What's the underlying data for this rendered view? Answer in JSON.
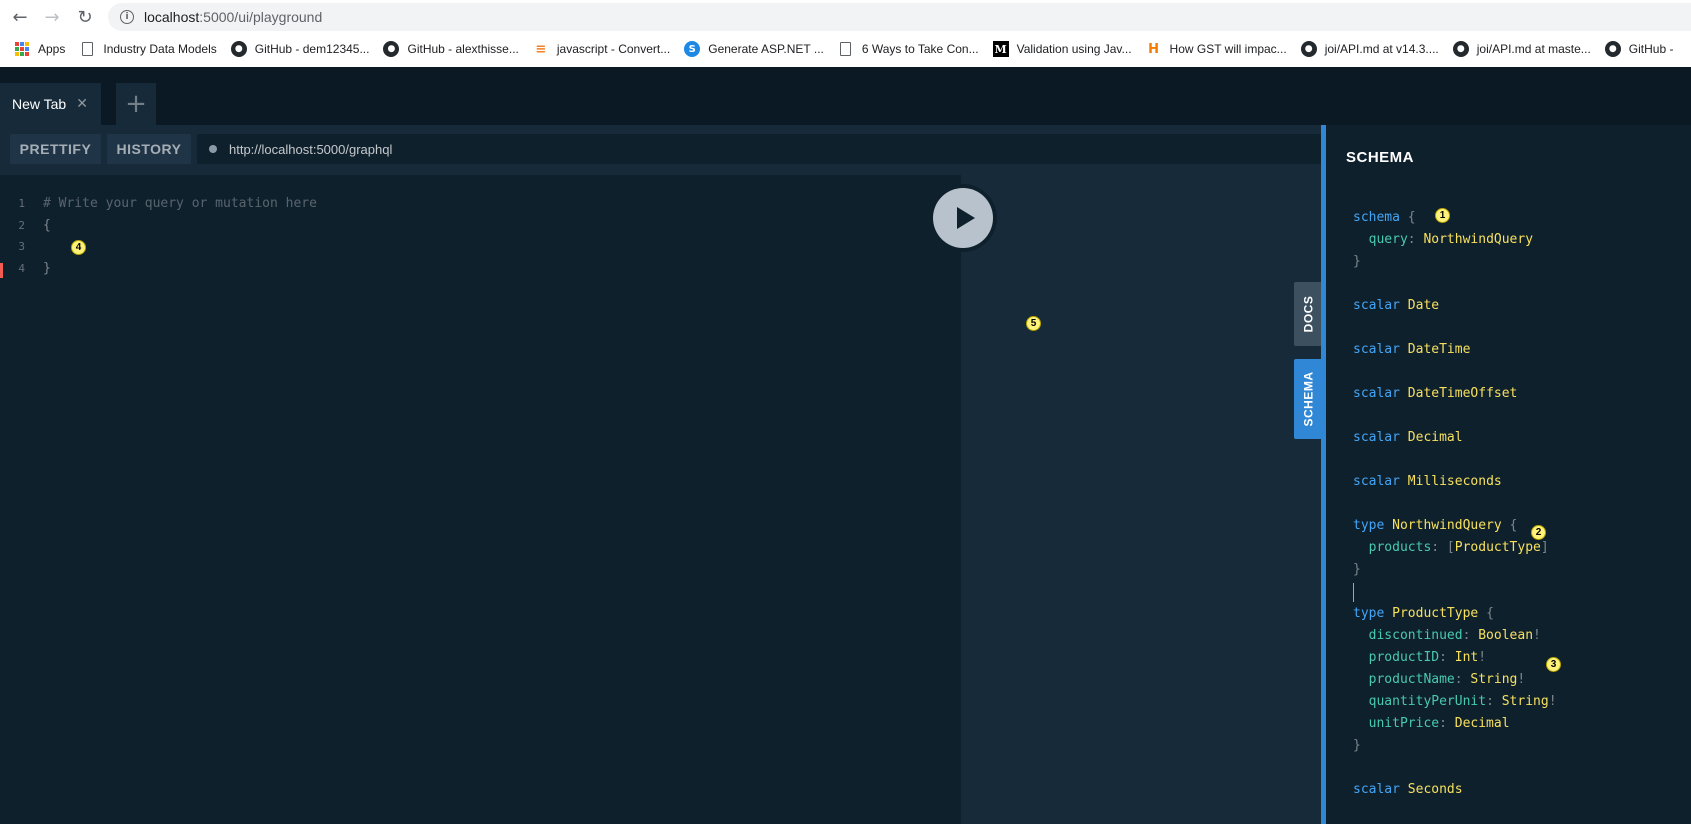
{
  "browser": {
    "url_host": "localhost",
    "url_rest": ":5000/ui/playground",
    "bookmarks": [
      {
        "label": "Apps",
        "icon": "apps-grid-icon"
      },
      {
        "label": "Industry Data Models",
        "icon": "page-icon"
      },
      {
        "label": "GitHub - dem12345...",
        "icon": "github-icon"
      },
      {
        "label": "GitHub - alexthisse...",
        "icon": "github-icon"
      },
      {
        "label": "javascript - Convert...",
        "icon": "stackoverflow-icon"
      },
      {
        "label": "Generate ASP.NET ...",
        "icon": "generic-site-icon"
      },
      {
        "label": "6 Ways to Take Con...",
        "icon": "page-icon"
      },
      {
        "label": "Validation using Jav...",
        "icon": "medium-icon"
      },
      {
        "label": "How GST will impac...",
        "icon": "h-site-icon"
      },
      {
        "label": "joi/API.md at v14.3....",
        "icon": "github-icon"
      },
      {
        "label": "joi/API.md at maste...",
        "icon": "github-icon"
      },
      {
        "label": "GitHub -",
        "icon": "github-icon"
      }
    ]
  },
  "tabs": {
    "active_title": "New Tab",
    "close_glyph": "✕",
    "add_glyph": "+"
  },
  "toolbar": {
    "prettify_label": "PRETTIFY",
    "history_label": "HISTORY",
    "endpoint": "http://localhost:5000/graphql"
  },
  "editor": {
    "lines": [
      {
        "num": "1",
        "text": "# Write your query or mutation here"
      },
      {
        "num": "2",
        "text": "{"
      },
      {
        "num": "3",
        "text": "  "
      },
      {
        "num": "4",
        "text": "}"
      }
    ]
  },
  "side_tabs": {
    "docs_label": "DOCS",
    "schema_label": "SCHEMA"
  },
  "schema_panel": {
    "title": "SCHEMA"
  },
  "markers": [
    "1",
    "2",
    "3",
    "4",
    "5"
  ],
  "colors": {
    "accent": "#2f87d6",
    "keyword": "#42a5f5",
    "type_name": "#f6e05e",
    "field": "#48c9b0"
  }
}
